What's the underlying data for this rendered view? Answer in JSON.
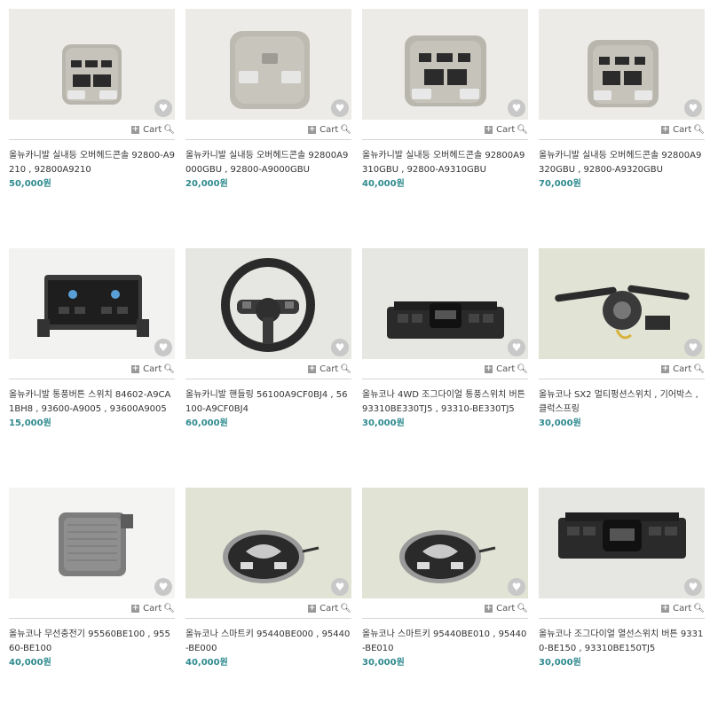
{
  "cart_label": "Cart",
  "colors": {
    "price": "#2f8a8f",
    "divider": "#d6d6d6",
    "fav_bg": "#c8c8c8"
  },
  "products": [
    {
      "image": "overhead-console-light",
      "title": "올뉴카니발 실내등 오버헤드콘솔 92800-A9210 , 92800A9210",
      "price": "50,000원"
    },
    {
      "image": "overhead-console-plain",
      "title": "올뉴카니발 실내등 오버헤드콘솔 92800A9000GBU , 92800-A9000GBU",
      "price": "20,000원"
    },
    {
      "image": "overhead-console-light",
      "title": "올뉴카니발 실내등 오버헤드콘솔 92800A9310GBU , 92800-A9310GBU",
      "price": "40,000원"
    },
    {
      "image": "overhead-console-light",
      "title": "올뉴카니발 실내등 오버헤드콘솔 92800A9320GBU , 92800-A9320GBU",
      "price": "70,000원"
    },
    {
      "image": "climate-switch-panel",
      "title": "올뉴카니발 통풍버튼 스위치 84602-A9CA1BH8 , 93600-A9005 , 93600A9005",
      "price": "15,000원"
    },
    {
      "image": "steering-wheel",
      "title": "올뉴카니발 핸들링 56100A9CF0BJ4 , 56100-A9CF0BJ4",
      "price": "60,000원"
    },
    {
      "image": "drive-mode-switch",
      "title": "올뉴코나 4WD 조그다이얼 통풍스위치 버튼 93310BE330TJ5 , 93310-BE330TJ5",
      "price": "30,000원"
    },
    {
      "image": "multifunction-switch",
      "title": "올뉴코나 SX2 멀티펑션스위치 , 기어박스 , 클럭스프링",
      "price": "30,000원"
    },
    {
      "image": "wireless-charger",
      "title": "올뉴코나 무선충전기 95560BE100 , 95560-BE100",
      "price": "40,000원"
    },
    {
      "image": "smart-key",
      "title": "올뉴코나 스마트키 95440BE000 , 95440-BE000",
      "price": "40,000원"
    },
    {
      "image": "smart-key",
      "title": "올뉴코나 스마트키 95440BE010 , 95440-BE010",
      "price": "30,000원"
    },
    {
      "image": "drive-mode-switch",
      "title": "올뉴코나 조그다이얼 열선스위치 버튼 93310-BE150 , 93310BE150TJ5",
      "price": "30,000원"
    }
  ]
}
